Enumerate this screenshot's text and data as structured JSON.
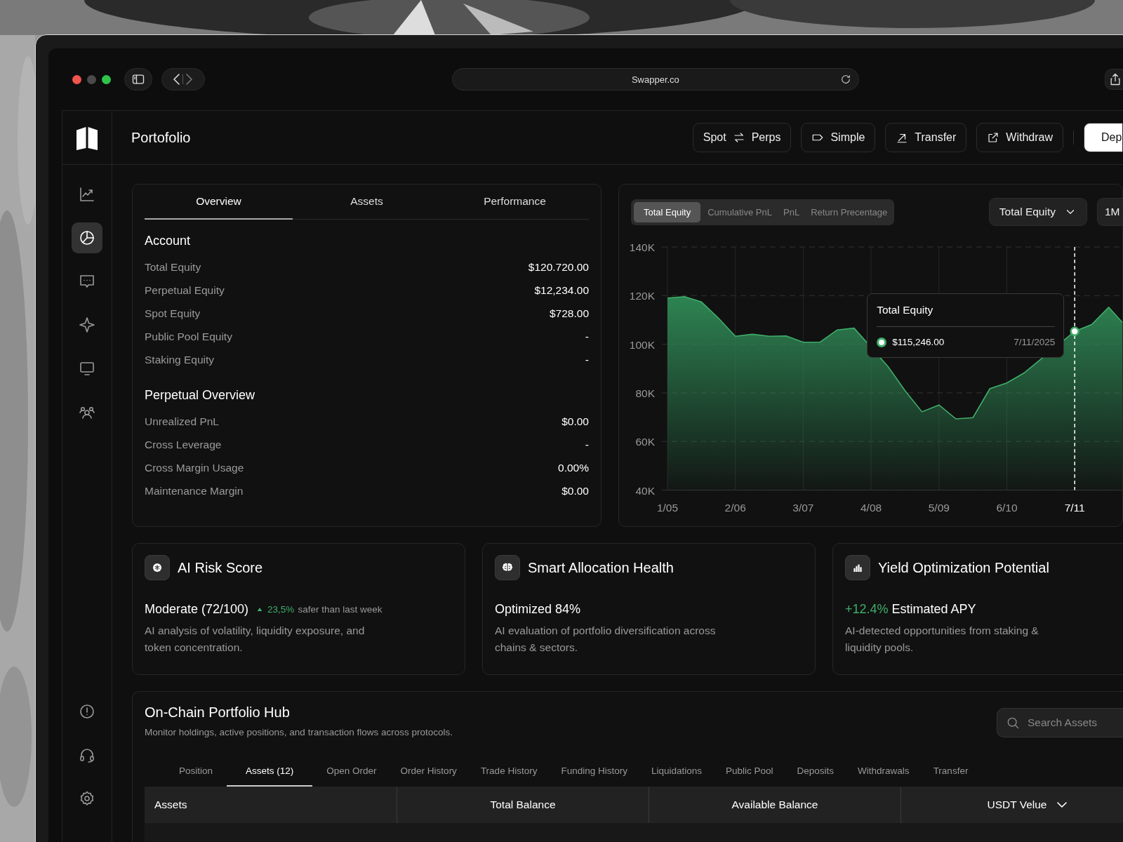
{
  "browser": {
    "url": "Swapper.co"
  },
  "sidebar": {
    "items": [
      {
        "selected": false
      },
      {
        "selected": true
      },
      {
        "selected": false
      },
      {
        "selected": false
      },
      {
        "selected": false
      },
      {
        "selected": false
      }
    ]
  },
  "header": {
    "title": "Portofolio",
    "buttons": [
      {
        "kind": "swap",
        "label": "Spot",
        "label2": "Perps"
      },
      {
        "kind": "simple",
        "label": "Simple"
      },
      {
        "kind": "transfer",
        "label": "Transfer"
      },
      {
        "kind": "withdraw",
        "label": "Withdraw"
      },
      {
        "kind": "primary",
        "label": "Dep"
      }
    ]
  },
  "overview": {
    "tabs": [
      {
        "label": "Overview",
        "selected": true
      },
      {
        "label": "Assets",
        "selected": false
      },
      {
        "label": "Performance",
        "selected": false
      }
    ],
    "sections": [
      {
        "title": "Account",
        "rows": [
          {
            "label": "Total Equity",
            "value": "$120.720.00"
          },
          {
            "label": "Perpetual Equity",
            "value": "$12,234.00"
          },
          {
            "label": "Spot Equity",
            "value": "$728.00"
          },
          {
            "label": "Public Pool Equity",
            "value": "-"
          },
          {
            "label": "Staking Equity",
            "value": "-"
          }
        ]
      },
      {
        "title": "Perpetual Overview",
        "rows": [
          {
            "label": "Unrealized PnL",
            "value": "$0.00"
          },
          {
            "label": "Cross Leverage",
            "value": "-"
          },
          {
            "label": "Cross Margin Usage",
            "value": "0.00%"
          },
          {
            "label": "Maintenance Margin",
            "value": "$0.00"
          }
        ]
      }
    ]
  },
  "chart": {
    "filters": [
      {
        "label": "Total Equity",
        "selected": true
      },
      {
        "label": "Cumulative PnL",
        "selected": false
      },
      {
        "label": "PnL",
        "selected": false
      },
      {
        "label": "Return Precentage",
        "selected": false
      }
    ],
    "dropdown": "Total Equity",
    "period": "1M",
    "tooltip": {
      "value": "$115,246.00",
      "date": "7/11/2025"
    },
    "chart_data": {
      "type": "area",
      "categories": [
        "1/05",
        null,
        null,
        null,
        "2/06",
        null,
        null,
        null,
        "3/07",
        null,
        null,
        null,
        "4/08",
        null,
        null,
        null,
        "5/09",
        null,
        null,
        null,
        "6/10",
        null,
        null,
        null,
        "7/11",
        null,
        null,
        null
      ],
      "series": [
        {
          "name": "Total Equity",
          "color": "#3fae6a",
          "values": [
            119.0,
            119.6,
            117.4,
            110.8,
            103.3,
            104.1,
            103.3,
            103.4,
            100.8,
            100.9,
            105.9,
            106.6,
            null,
            90.8,
            80.9,
            72.2,
            75.0,
            69.3,
            69.8,
            81.7,
            84.1,
            88.1,
            null,
            null,
            105.3,
            108.1,
            115.2,
            107.5
          ]
        }
      ],
      "ylim": [
        40,
        140
      ],
      "grid": true,
      "yticks": [
        {
          "value": 140,
          "label": "140K"
        },
        {
          "value": 120,
          "label": "120K"
        },
        {
          "value": 100,
          "label": "100K"
        },
        {
          "value": 80,
          "label": "80K"
        },
        {
          "value": 60,
          "label": "60K"
        },
        {
          "value": 40,
          "label": "40K"
        }
      ],
      "annotations": [
        {
          "x": "7/11"
        }
      ]
    }
  },
  "insights": [
    {
      "title": "AI Risk Score",
      "value": "Moderate (72/100)",
      "trend": {
        "value": "23,5%",
        "note": "safer than last week"
      },
      "description": "AI analysis of volatility, liquidity exposure, and token concentration."
    },
    {
      "title": "Smart Allocation Health",
      "value": "Optimized 84%",
      "description": "AI evaluation of portfolio diversification across chains & sectors."
    },
    {
      "title": "Yield Optimization Potential",
      "gain": "+12.4%",
      "value": "Estimated APY",
      "description": "AI-detected opportunities from staking & liquidity pools."
    }
  ],
  "hub": {
    "title": "On-Chain Portfolio Hub",
    "subtitle": "Monitor holdings, active positions, and transaction flows across protocols.",
    "search": {
      "placeholder": "Search Assets"
    },
    "tabs": [
      {
        "label": "Position",
        "selected": false
      },
      {
        "label": "Assets (12)",
        "selected": true
      },
      {
        "label": "Open Order",
        "selected": false
      },
      {
        "label": "Order History",
        "selected": false
      },
      {
        "label": "Trade History",
        "selected": false
      },
      {
        "label": "Funding History",
        "selected": false
      },
      {
        "label": "Liquidations",
        "selected": false
      },
      {
        "label": "Public Pool",
        "selected": false
      },
      {
        "label": "Deposits",
        "selected": false
      },
      {
        "label": "Withdrawals",
        "selected": false
      },
      {
        "label": "Transfer",
        "selected": false
      }
    ],
    "table": {
      "columns": [
        {
          "label": "Assets"
        },
        {
          "label": "Total Balance"
        },
        {
          "label": "Available Balance"
        },
        {
          "label": "USDT Velue",
          "sortable": true
        }
      ]
    }
  }
}
